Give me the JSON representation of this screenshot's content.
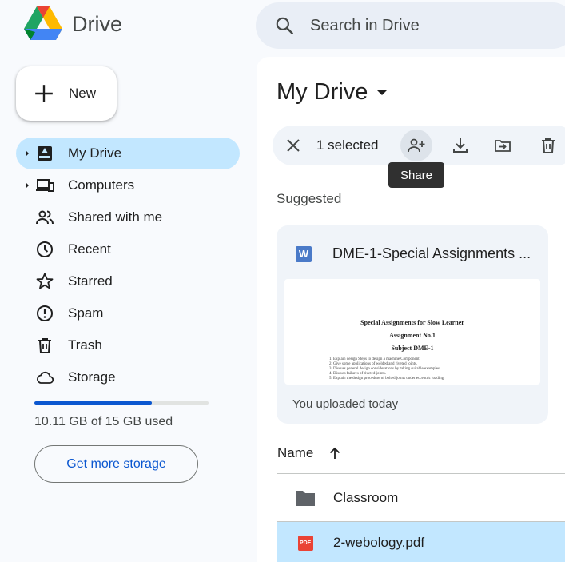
{
  "app": {
    "name": "Drive"
  },
  "search": {
    "placeholder": "Search in Drive"
  },
  "new_button": {
    "label": "New"
  },
  "sidebar": {
    "items": [
      {
        "label": "My Drive",
        "icon": "my-drive-icon",
        "active": true,
        "expandable": true
      },
      {
        "label": "Computers",
        "icon": "computers-icon",
        "active": false,
        "expandable": true
      },
      {
        "label": "Shared with me",
        "icon": "shared-icon",
        "active": false,
        "expandable": false
      },
      {
        "label": "Recent",
        "icon": "clock-icon",
        "active": false,
        "expandable": false
      },
      {
        "label": "Starred",
        "icon": "star-icon",
        "active": false,
        "expandable": false
      },
      {
        "label": "Spam",
        "icon": "spam-icon",
        "active": false,
        "expandable": false
      },
      {
        "label": "Trash",
        "icon": "trash-icon",
        "active": false,
        "expandable": false
      },
      {
        "label": "Storage",
        "icon": "cloud-icon",
        "active": false,
        "expandable": false
      }
    ]
  },
  "storage": {
    "used_text": "10.11 GB of 15 GB used",
    "used_fraction": 0.674,
    "button_label": "Get more storage"
  },
  "main": {
    "title": "My Drive",
    "selection": {
      "count_label": "1 selected",
      "tooltip": "Share"
    },
    "suggested_label": "Suggested",
    "suggested_card": {
      "file_icon": "W",
      "file_name": "DME-1-Special Assignments ...",
      "footer": "You uploaded today",
      "preview": {
        "line1": "Special Assignments for Slow Learner",
        "line2": "Assignment No.1",
        "line3": "Subject DME-1",
        "items": [
          "1. Explain design Steps to design a machine Component.",
          "2. Give some applications of welded and riveted joints.",
          "3. Discuss general design considerations by taking suitable examples.",
          "4. Discuss failures of riveted joints.",
          "5. Explain the design procedure of bolted joints under eccentric loading."
        ]
      }
    },
    "list": {
      "name_header": "Name",
      "rows": [
        {
          "name": "Classroom",
          "type": "folder",
          "selected": false
        },
        {
          "name": "2-webology.pdf",
          "type": "pdf",
          "badge": "PDF",
          "selected": true
        }
      ]
    }
  },
  "colors": {
    "accent": "#0b57d0",
    "selected": "#c2e7ff",
    "panel": "#f0f4f9",
    "background": "#f8fafd"
  }
}
